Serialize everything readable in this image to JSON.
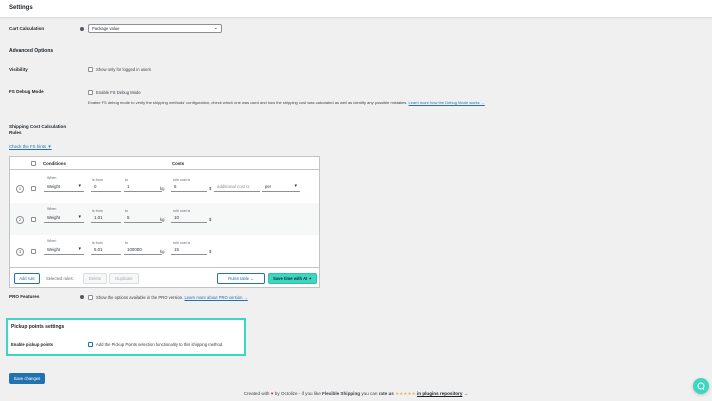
{
  "header": {
    "title": "Settings"
  },
  "cart_calculation": {
    "label": "Cart Calculation",
    "value": "Package value"
  },
  "advanced": {
    "title": "Advanced Options"
  },
  "visibility": {
    "label": "Visibility",
    "option": "Show only for logged in users"
  },
  "debug": {
    "label": "FS Debug Mode",
    "option": "Enable FS Debug Mode",
    "description": "Enable FS debug mode to verify the shipping methods' configuration, check which one was used and how the shipping cost was calculated as well as identify any possible mistakes.",
    "link": "Learn more how the Debug Mode works →"
  },
  "rules": {
    "label_line1": "Shipping Cost Calculation",
    "label_line2": "Rules",
    "hints_link": "Check the FS hints ▼",
    "col_conditions": "Conditions",
    "col_costs": "Costs",
    "when_label": "When",
    "from_label": "is from",
    "to_label": "to",
    "cost_label": "rule cost is",
    "unit_kg": "kg",
    "currency": "$",
    "additional_placeholder": "additional cost is",
    "per_label": "per",
    "rows": [
      {
        "num": "1",
        "when": "Weight",
        "from": "0",
        "to": "1",
        "cost": "5"
      },
      {
        "num": "2",
        "when": "Weight",
        "from": "1.01",
        "to": "5",
        "cost": "10"
      },
      {
        "num": "3",
        "when": "Weight",
        "from": "5.01",
        "to": "100000",
        "cost": "15"
      }
    ],
    "add_rule": "Add rule",
    "selected_rules": "Selected rules:",
    "delete": "Delete",
    "duplicate": "Duplicate",
    "rules_table": "Rules table",
    "save_time_ai": "Save time with AI ✦"
  },
  "pro": {
    "label": "PRO Features",
    "option": "Show the options available in the PRO version.",
    "link": "Learn more about PRO version →"
  },
  "pickup": {
    "title": "Pickup points settings",
    "label": "Enable pickup points",
    "option": "Add the Pickup Points selection functionality to this shipping method."
  },
  "save_button": "Save changes",
  "footer": {
    "text1": "Created with",
    "heart": "♥",
    "text2": "by Octolize - if you like",
    "brand": "Flexible Shipping",
    "text3": "you can",
    "rate": "rate us",
    "stars": "★★★★★",
    "repo": "in plugins repository",
    "arrow": "→"
  },
  "colors": {
    "accent": "#2271b1",
    "ai": "#3dd6c0",
    "highlight": "#3dd6c0",
    "heart": "#d63638",
    "stars": "#f0b849"
  }
}
